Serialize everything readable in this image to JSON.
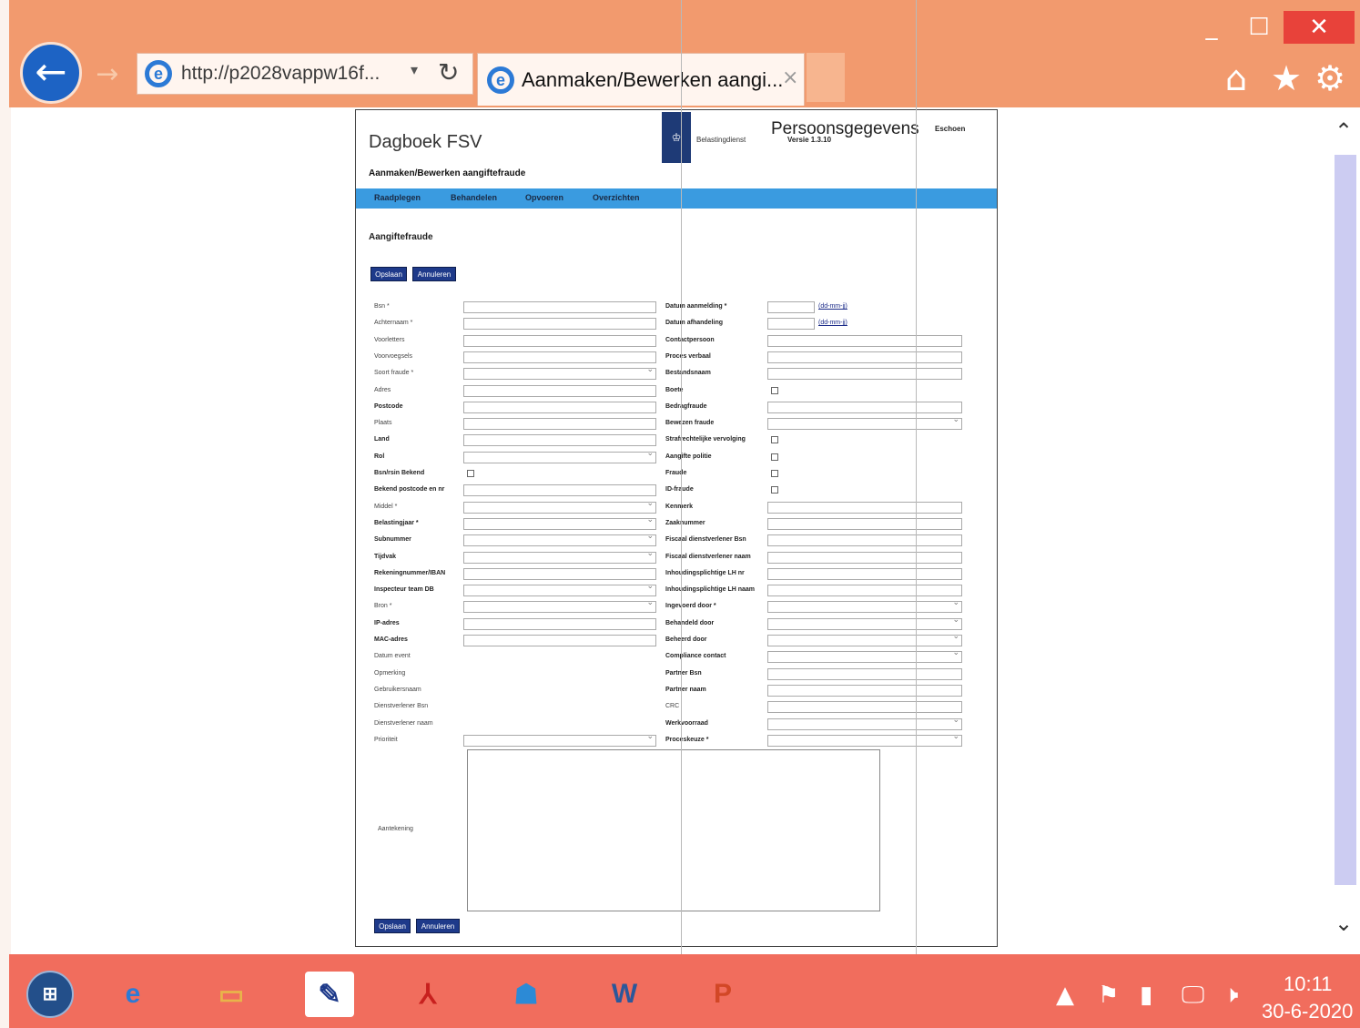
{
  "window": {
    "minimize": "_",
    "maximize": "☐",
    "close": "✕"
  },
  "browser": {
    "back": "←",
    "forward": "→",
    "url": "http://p2028vappw16f...",
    "url_dropdown": "▾",
    "refresh": "↻",
    "tab_title": "Aanmaken/Bewerken aangi...",
    "tab_close": "×",
    "icons": [
      "home-icon",
      "star-icon",
      "gear-icon"
    ],
    "home": "⌂",
    "star": "★",
    "gear": "⚙"
  },
  "page": {
    "app_title": "Dagboek FSV",
    "emblem": "♔",
    "ministry": "Belastingdienst",
    "privacy_banner": "Persoonsgegevens",
    "user": "Eschoen",
    "version": "Versie 1.3.10",
    "heading": "Aanmaken/Bewerken aangiftefraude",
    "nav": [
      "Raadplegen",
      "Behandelen",
      "Opvoeren",
      "Overzichten"
    ],
    "section_title": "Aangiftefraude",
    "save": "Opslaan",
    "cancel": "Annuleren",
    "remark_label": "Aantekening"
  },
  "form_left": [
    {
      "label": "Bsn *",
      "type": "input",
      "bold": false
    },
    {
      "label": "Achternaam *",
      "type": "input",
      "bold": false
    },
    {
      "label": "Voorletters",
      "type": "input",
      "bold": false
    },
    {
      "label": "Voorvoegsels",
      "type": "input",
      "bold": false
    },
    {
      "label": "Soort fraude *",
      "type": "select",
      "bold": false
    },
    {
      "label": "Adres",
      "type": "input",
      "bold": false
    },
    {
      "label": "Postcode",
      "type": "input",
      "bold": true
    },
    {
      "label": "Plaats",
      "type": "input",
      "bold": false
    },
    {
      "label": "Land",
      "type": "input",
      "bold": true
    },
    {
      "label": "Rol",
      "type": "select",
      "bold": true
    },
    {
      "label": "Bsn/rsin Bekend",
      "type": "check",
      "bold": true
    },
    {
      "label": "Bekend postcode en nr",
      "type": "input",
      "bold": true
    },
    {
      "label": "Middel *",
      "type": "select",
      "bold": false
    },
    {
      "label": "Belastingjaar *",
      "type": "select",
      "bold": true
    },
    {
      "label": "Subnummer",
      "type": "select",
      "bold": true
    },
    {
      "label": "Tijdvak",
      "type": "select",
      "bold": true
    },
    {
      "label": "Rekeningnummer/IBAN",
      "type": "input",
      "bold": true
    },
    {
      "label": "Inspecteur team DB",
      "type": "select",
      "bold": true
    },
    {
      "label": "Bron *",
      "type": "select",
      "bold": false
    },
    {
      "label": "IP-adres",
      "type": "input",
      "bold": true
    },
    {
      "label": "MAC-adres",
      "type": "input",
      "bold": true
    },
    {
      "label": "Datum event",
      "type": "none",
      "bold": false
    },
    {
      "label": "Opmerking",
      "type": "none",
      "bold": false
    },
    {
      "label": "Gebruikersnaam",
      "type": "none",
      "bold": false
    },
    {
      "label": "Dienstverlener Bsn",
      "type": "none",
      "bold": false
    },
    {
      "label": "Dienstverlener naam",
      "type": "none",
      "bold": false
    },
    {
      "label": "Prioriteit",
      "type": "select",
      "bold": false
    }
  ],
  "form_right": [
    {
      "label": "Datum aanmelding *",
      "type": "date",
      "bold": true,
      "hint": "(dd-mm-jj)"
    },
    {
      "label": "Datum afhandeling",
      "type": "date",
      "bold": true,
      "hint": "(dd-mm-jj)"
    },
    {
      "label": "Contactpersoon",
      "type": "input",
      "bold": true
    },
    {
      "label": "Proces verbaal",
      "type": "input",
      "bold": true
    },
    {
      "label": "Bestandsnaam",
      "type": "input",
      "bold": true
    },
    {
      "label": "Boete",
      "type": "check",
      "bold": true
    },
    {
      "label": "Bedragfraude",
      "type": "input",
      "bold": true
    },
    {
      "label": "Bewezen fraude",
      "type": "select",
      "bold": true
    },
    {
      "label": "Strafrechtelijke vervolging",
      "type": "check",
      "bold": true
    },
    {
      "label": "Aangifte politie",
      "type": "check",
      "bold": true
    },
    {
      "label": "Fraude",
      "type": "check",
      "bold": true
    },
    {
      "label": "ID-fraude",
      "type": "check",
      "bold": true
    },
    {
      "label": "Kenmerk",
      "type": "input",
      "bold": true
    },
    {
      "label": "Zaaknummer",
      "type": "input",
      "bold": true
    },
    {
      "label": "Fiscaal dienstverlener Bsn",
      "type": "input",
      "bold": true
    },
    {
      "label": "Fiscaal dienstverlener naam",
      "type": "input",
      "bold": true
    },
    {
      "label": "Inhoudingsplichtige LH nr",
      "type": "input",
      "bold": true
    },
    {
      "label": "Inhoudingsplichtige LH naam",
      "type": "input",
      "bold": true
    },
    {
      "label": "Ingevoerd door *",
      "type": "select",
      "bold": true
    },
    {
      "label": "Behandeld door",
      "type": "select",
      "bold": true
    },
    {
      "label": "Beheerd door",
      "type": "select",
      "bold": true
    },
    {
      "label": "Compliance contact",
      "type": "select",
      "bold": true
    },
    {
      "label": "Partner Bsn",
      "type": "input",
      "bold": true
    },
    {
      "label": "Partner naam",
      "type": "input",
      "bold": true
    },
    {
      "label": "CRC",
      "type": "input",
      "bold": false
    },
    {
      "label": "Werkvoorraad",
      "type": "select",
      "bold": true
    },
    {
      "label": "Proceskeuze *",
      "type": "select",
      "bold": true
    }
  ],
  "taskbar": {
    "start": "⊞",
    "apps": [
      {
        "name": "ie",
        "glyph": "e",
        "color": "#2c7ad6"
      },
      {
        "name": "explorer",
        "glyph": "▭",
        "color": "#e8b44a"
      },
      {
        "name": "notes",
        "glyph": "✎",
        "color": "#ffffff"
      },
      {
        "name": "acrobat",
        "glyph": "⅄",
        "color": "#c8201e"
      },
      {
        "name": "people",
        "glyph": "☗",
        "color": "#2c8ad6"
      },
      {
        "name": "word",
        "glyph": "W",
        "color": "#2b579a"
      },
      {
        "name": "powerpoint",
        "glyph": "P",
        "color": "#d24726"
      }
    ],
    "tray": [
      "▲",
      "⚑",
      "▮",
      "🖵",
      "🕨"
    ],
    "time": "10:11",
    "date": "30-6-2020"
  }
}
